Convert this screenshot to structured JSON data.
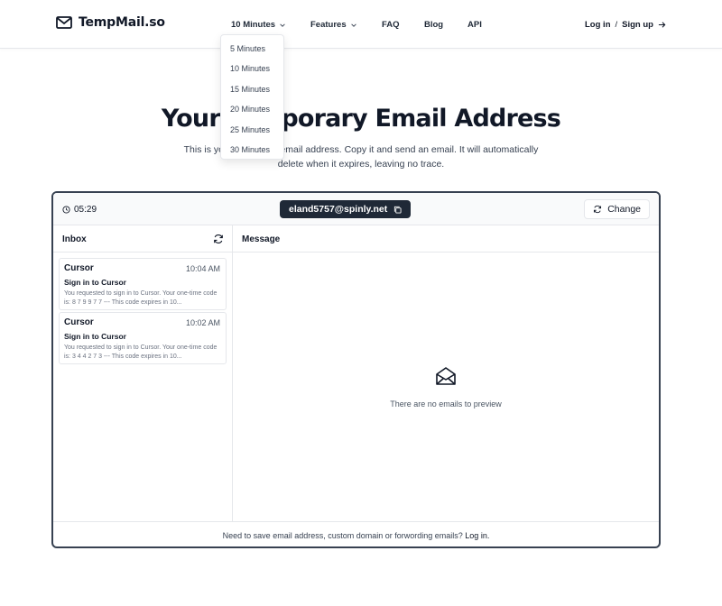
{
  "brand": {
    "name": "TempMail.so",
    "icon": "mail-icon"
  },
  "nav": {
    "duration_label": "10 Minutes",
    "features_label": "Features",
    "faq_label": "FAQ",
    "blog_label": "Blog",
    "api_label": "API",
    "login_label": "Log in",
    "separator": "/",
    "signup_label": "Sign up"
  },
  "duration_menu": {
    "options": [
      "5 Minutes",
      "10 Minutes",
      "15 Minutes",
      "20 Minutes",
      "25 Minutes",
      "30 Minutes"
    ]
  },
  "hero": {
    "title": "Your Temporary Email Address",
    "description": "This is your temporary email address. Copy it and send an email. It will automatically delete when it expires, leaving no trace."
  },
  "mailbox": {
    "timer": "05:29",
    "address": "eland5757@spinly.net",
    "change_label": "Change",
    "inbox_label": "Inbox",
    "message_label": "Message",
    "empty_text": "There are no emails to preview",
    "emails": [
      {
        "from": "Cursor",
        "time": "10:04 AM",
        "subject": "Sign in to Cursor",
        "preview": "You requested to sign in to Cursor. Your one-time code is: 8 7 9 9 7 7 --- This code expires in 10..."
      },
      {
        "from": "Cursor",
        "time": "10:02 AM",
        "subject": "Sign in to Cursor",
        "preview": "You requested to sign in to Cursor. Your one-time code is: 3 4 4 2 7 3 --- This code expires in 10..."
      }
    ],
    "footer_text": "Need to save email address, custom domain or forwording emails?",
    "footer_link": "Log in."
  },
  "colors": {
    "accent": "#1f2937",
    "border": "#e5e7eb",
    "text": "#111827"
  }
}
